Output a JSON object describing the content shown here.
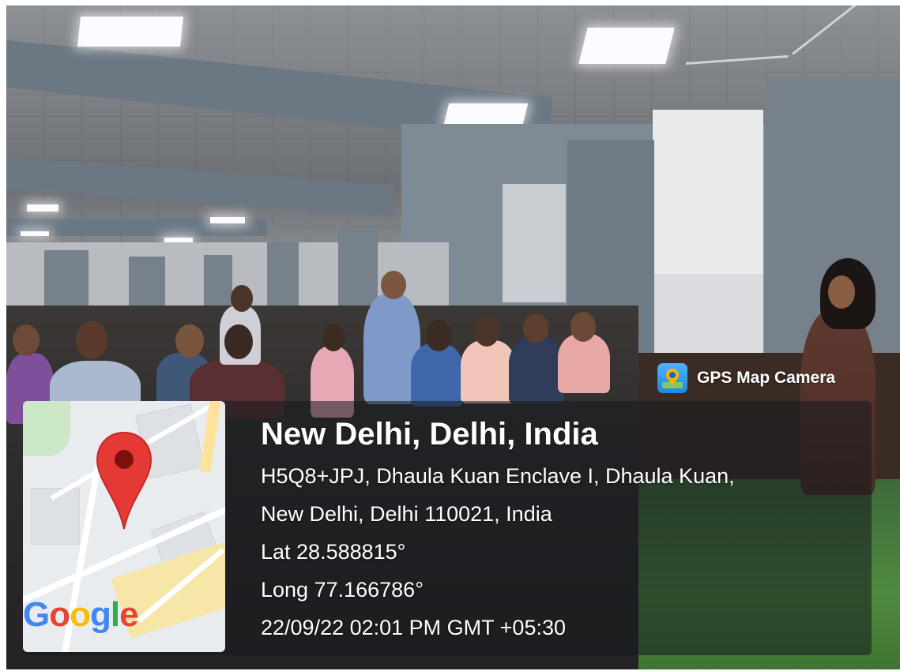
{
  "stamp": {
    "app_badge": "GPS Map Camera",
    "city": "New Delhi, Delhi, India",
    "address_line1": "H5Q8+JPJ, Dhaula Kuan Enclave I, Dhaula Kuan,",
    "address_line2": "New Delhi, Delhi 110021, India",
    "latitude": "Lat 28.588815°",
    "longitude": "Long 77.166786°",
    "datetime": "22/09/22 02:01 PM GMT +05:30"
  },
  "map": {
    "provider_logo": "Google",
    "marker_icon": "map-pin-icon",
    "marker_color": "#E53935"
  },
  "colors": {
    "overlay": "#161a1e",
    "google_blue": "#4285F4",
    "google_red": "#EA4335",
    "google_yellow": "#FBBC05",
    "google_green": "#34A853"
  }
}
